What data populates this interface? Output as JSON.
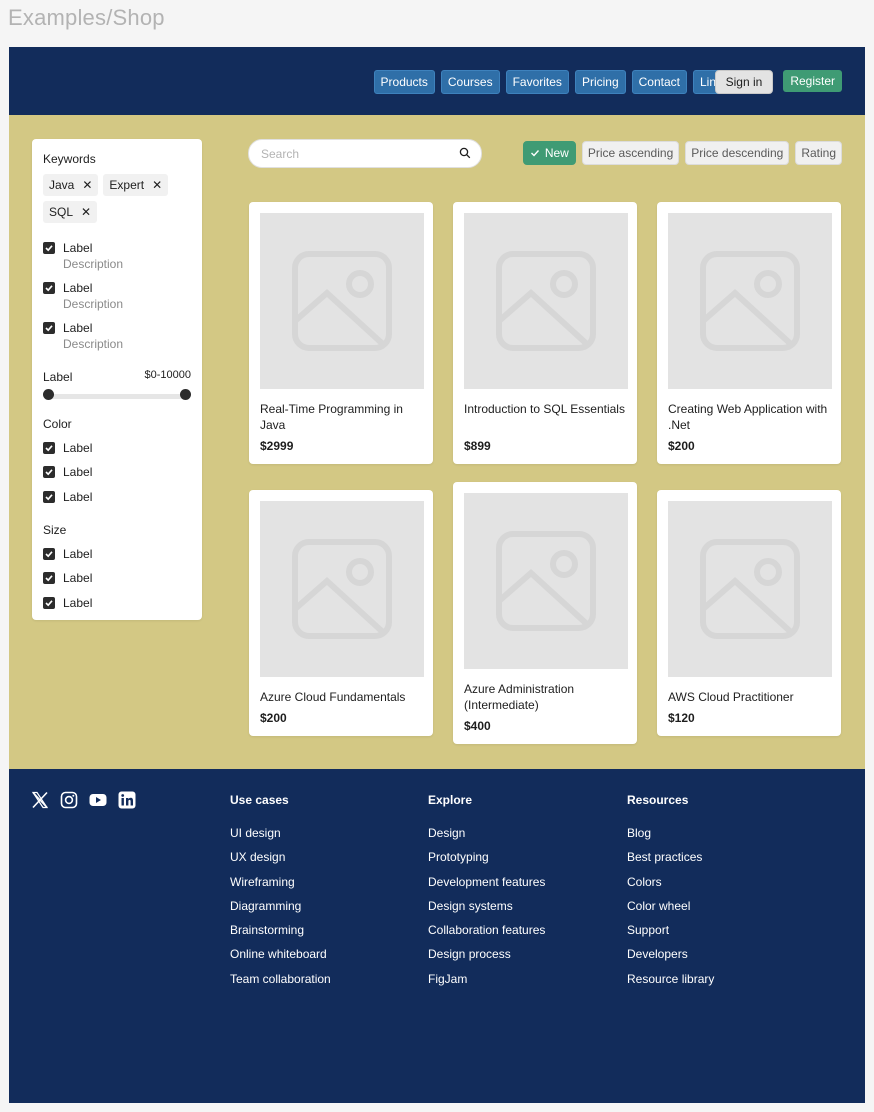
{
  "page_title": "Examples/Shop",
  "header": {
    "nav": [
      "Products",
      "Courses",
      "Favorites",
      "Pricing",
      "Contact",
      "Link"
    ],
    "sign_in": "Sign in",
    "register": "Register"
  },
  "filters": {
    "keywords_title": "Keywords",
    "chips": [
      "Java",
      "Expert",
      "SQL"
    ],
    "checkboxes": [
      {
        "label": "Label",
        "description": "Description"
      },
      {
        "label": "Label",
        "description": "Description"
      },
      {
        "label": "Label",
        "description": "Description"
      }
    ],
    "range_label": "Label",
    "range_value": "$0-10000",
    "color_title": "Color",
    "color_options": [
      "Label",
      "Label",
      "Label"
    ],
    "size_title": "Size",
    "size_options": [
      "Label",
      "Label",
      "Label"
    ]
  },
  "search": {
    "placeholder": "Search"
  },
  "sort": {
    "options": [
      "New",
      "Price ascending",
      "Price descending",
      "Rating"
    ],
    "selected": "New"
  },
  "products": [
    {
      "title": "Real-Time Programming in Java",
      "price": "$2999"
    },
    {
      "title": "Introduction to SQL Essentials",
      "price": "$899"
    },
    {
      "title": "Creating Web Application with .Net",
      "price": "$200"
    },
    {
      "title": "Azure Cloud Fundamentals",
      "price": "$200"
    },
    {
      "title": "Azure Administration (Intermediate)",
      "price": "$400"
    },
    {
      "title": "AWS Cloud Practitioner",
      "price": "$120"
    }
  ],
  "footer": {
    "socials": [
      "x-icon",
      "instagram-icon",
      "youtube-icon",
      "linkedin-icon"
    ],
    "columns": [
      {
        "title": "Use cases",
        "links": [
          "UI design",
          "UX design",
          "Wireframing",
          "Diagramming",
          "Brainstorming",
          "Online whiteboard",
          "Team collaboration"
        ]
      },
      {
        "title": "Explore",
        "links": [
          "Design",
          "Prototyping",
          "Development features",
          "Design systems",
          "Collaboration features",
          "Design process",
          "FigJam"
        ]
      },
      {
        "title": "Resources",
        "links": [
          "Blog",
          "Best practices",
          "Colors",
          "Color wheel",
          "Support",
          "Developers",
          "Resource library"
        ]
      }
    ]
  },
  "colors": {
    "header_bg": "#122c5b",
    "main_bg": "#d3c884",
    "nav_button": "#2f6fa8",
    "accent_green": "#3f9b74"
  }
}
